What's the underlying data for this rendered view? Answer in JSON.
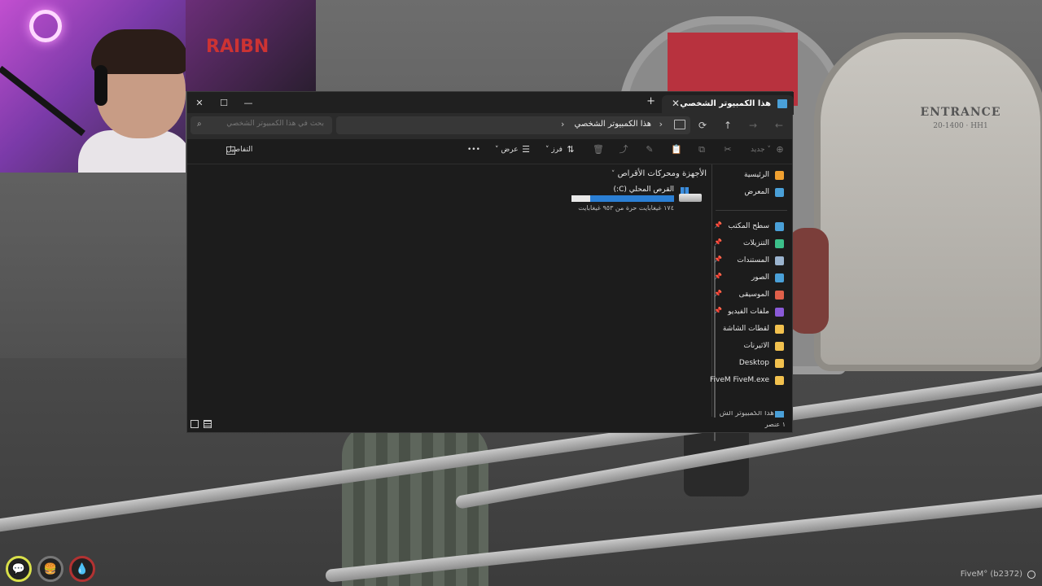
{
  "window": {
    "tab_title": "هذا الكمبيوتر الشخصي",
    "tab_close": "✕",
    "new_tab": "+",
    "minimize": "—",
    "maximize": "☐",
    "close": "✕"
  },
  "address_bar": {
    "breadcrumb": "هذا الكمبيوتر الشخصي",
    "separator": "›",
    "expand_chevron": "›",
    "search_placeholder": "بحث في هذا الكمبيوتر الشخصي",
    "search_value": ""
  },
  "command_bar": {
    "new_label": "جديد",
    "sort_label": "فرز",
    "view_label": "عرض",
    "more_label": "•••",
    "details_label": "التفاصيل"
  },
  "sidebar": {
    "items": [
      {
        "label": "الرئيسية",
        "icon": "home-icon",
        "color": "#f0a030",
        "pinned": false
      },
      {
        "label": "المعرض",
        "icon": "gallery-icon",
        "color": "#4aa0d8",
        "pinned": false
      },
      {
        "label": "سطح المكتب",
        "icon": "desktop-icon",
        "color": "#4aa0d8",
        "pinned": true
      },
      {
        "label": "التنزيلات",
        "icon": "download-icon",
        "color": "#3cc08a",
        "pinned": true
      },
      {
        "label": "المستندات",
        "icon": "documents-icon",
        "color": "#9bb4cf",
        "pinned": true
      },
      {
        "label": "الصور",
        "icon": "pictures-icon",
        "color": "#4aa0d8",
        "pinned": true
      },
      {
        "label": "الموسيقى",
        "icon": "music-icon",
        "color": "#e0604a",
        "pinned": true
      },
      {
        "label": "ملفات الفيديو",
        "icon": "videos-icon",
        "color": "#8a5ad8",
        "pinned": true
      },
      {
        "label": "لقطات الشاشة",
        "icon": "folder-icon",
        "color": "#f2c14e",
        "pinned": false
      },
      {
        "label": "الاثيرنات",
        "icon": "folder-icon",
        "color": "#f2c14e",
        "pinned": false
      },
      {
        "label": "Desktop",
        "icon": "folder-icon",
        "color": "#f2c14e",
        "pinned": false
      },
      {
        "label": "FiveM FiveM.exe",
        "icon": "folder-icon",
        "color": "#f2c14e",
        "pinned": false
      }
    ],
    "partial_item": "هذا الكمبيوتر الش"
  },
  "content": {
    "section_header": "الأجهزة ومحركات الأقراص",
    "drive": {
      "name": "القرص المحلي (C:)",
      "free_text": "١٧٤ غيغابايت حرة من ٩٥٣ غيغابايت",
      "used_fraction": 0.817
    }
  },
  "status_bar": {
    "item_count": "١ عنصر"
  },
  "game": {
    "entrance_sign": "ENTRANCE",
    "entrance_sub": "20-1400 · HH1",
    "fivem_build": "FiveM° (b2372)",
    "chair_brand": "RAIBN"
  },
  "colors": {
    "accent": "#2b7fd4",
    "window_bg": "#1c1c1c"
  }
}
